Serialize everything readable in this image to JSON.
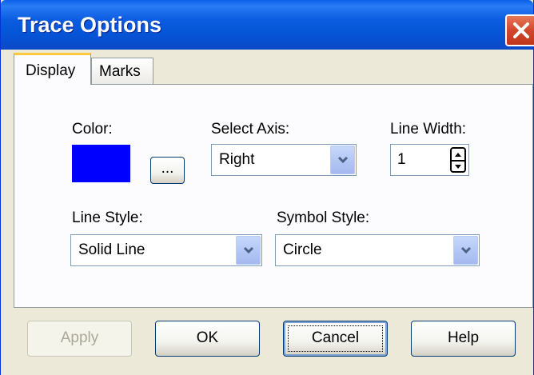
{
  "window": {
    "title": "Trace Options"
  },
  "tabs": [
    {
      "label": "Display",
      "active": true
    },
    {
      "label": "Marks",
      "active": false
    }
  ],
  "display": {
    "color_label": "Color:",
    "color_value": "#0000FF",
    "browse_label": "...",
    "axis_label": "Select Axis:",
    "axis_value": "Right",
    "line_width_label": "Line Width:",
    "line_width_value": "1",
    "line_style_label": "Line Style:",
    "line_style_value": "Solid Line",
    "symbol_style_label": "Symbol Style:",
    "symbol_style_value": "Circle"
  },
  "buttons": {
    "apply": "Apply",
    "ok": "OK",
    "cancel": "Cancel",
    "help": "Help"
  }
}
